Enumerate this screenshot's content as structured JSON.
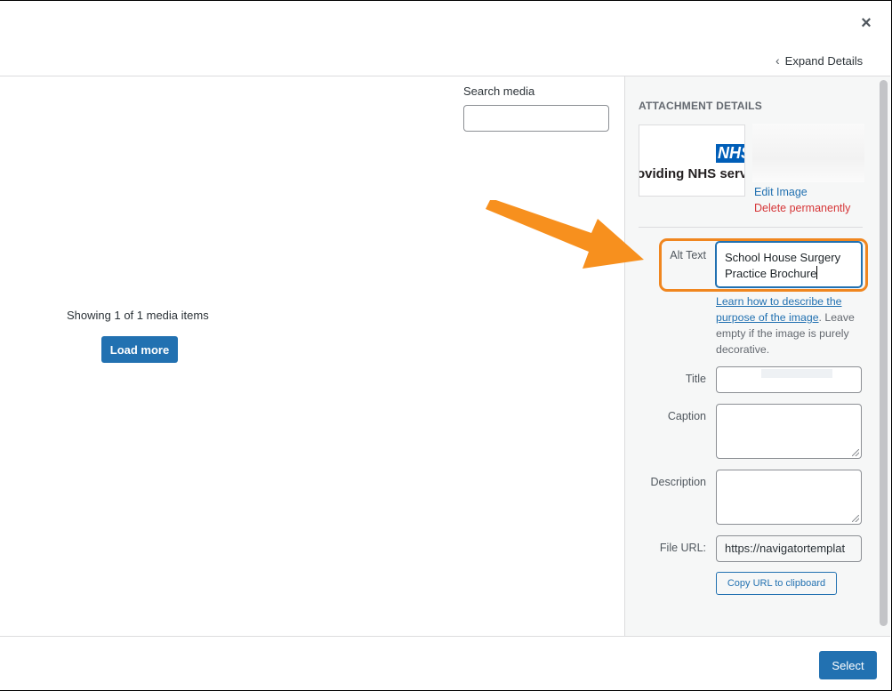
{
  "header": {
    "close_label": "×",
    "expand_details_label": "Expand Details",
    "expand_details_icon": "chevron-left-icon"
  },
  "search": {
    "label": "Search media",
    "value": "",
    "placeholder": ""
  },
  "library": {
    "showing_text": "Showing 1 of 1 media items",
    "load_more_label": "Load more"
  },
  "attachment": {
    "heading": "ATTACHMENT DETAILS",
    "thumbnail": {
      "logo_text": "NHS",
      "tagline_text": "oviding NHS servic"
    },
    "edit_image_label": "Edit Image",
    "delete_label": "Delete permanently",
    "fields": {
      "alt_text_label": "Alt Text",
      "alt_text_line1": "School House Surgery",
      "alt_text_line2": "Practice Brochure",
      "help_link_text": "Learn how to describe the purpose of the image",
      "help_rest_text": ". Leave empty if the image is purely decorative.",
      "title_label": "Title",
      "title_value": "",
      "caption_label": "Caption",
      "caption_value": "",
      "description_label": "Description",
      "description_value": "",
      "file_url_label": "File URL:",
      "file_url_value": "https://navigatortemplat",
      "copy_url_label": "Copy URL to clipboard"
    }
  },
  "footer": {
    "select_label": "Select"
  },
  "colors": {
    "accent": "#2271b1",
    "danger": "#d63638",
    "highlight": "#f0861f",
    "nhs_blue": "#005eb8"
  }
}
